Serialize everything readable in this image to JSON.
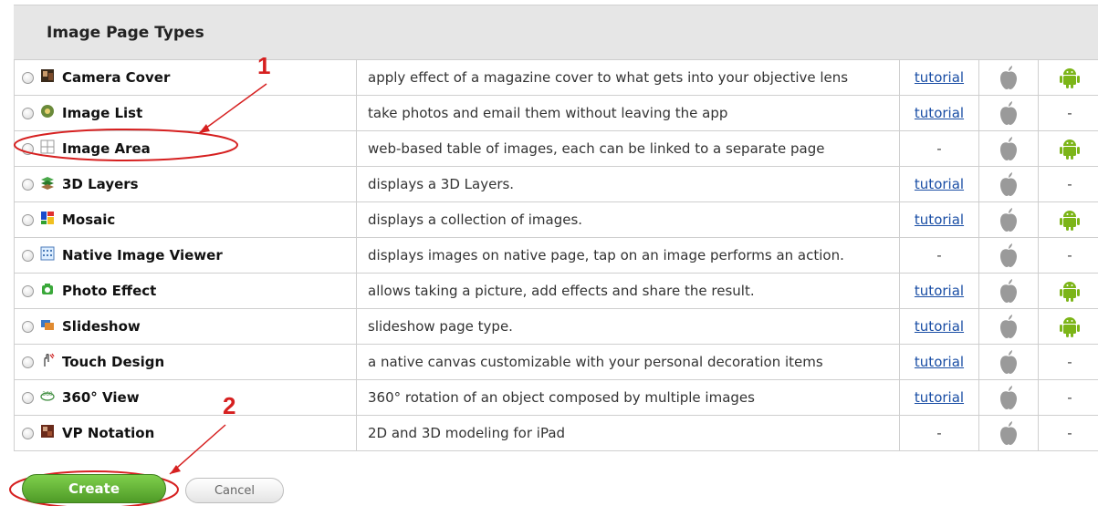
{
  "section": {
    "title": "Image Page Types"
  },
  "tutorial_link_label": "tutorial",
  "dash": "-",
  "rows": [
    {
      "name": "Camera Cover",
      "icon": "camera-cover-icon",
      "description": "apply effect of a magazine cover to what gets into your objective lens",
      "tutorial": true,
      "ios": true,
      "android": true
    },
    {
      "name": "Image List",
      "icon": "image-list-icon",
      "description": "take photos and email them without leaving the app",
      "tutorial": true,
      "ios": true,
      "android": false
    },
    {
      "name": "Image Area",
      "icon": "image-area-grid-icon",
      "description": "web-based table of images, each can be linked to a separate page",
      "tutorial": false,
      "ios": true,
      "android": true
    },
    {
      "name": "3D Layers",
      "icon": "3d-layers-icon",
      "description": "displays a 3D Layers.",
      "tutorial": true,
      "ios": true,
      "android": false
    },
    {
      "name": "Mosaic",
      "icon": "mosaic-icon",
      "description": "displays a collection of images.",
      "tutorial": true,
      "ios": true,
      "android": true
    },
    {
      "name": "Native Image Viewer",
      "icon": "native-image-viewer-icon",
      "description": "displays images on native page, tap on an image performs an action.",
      "tutorial": false,
      "ios": true,
      "android": false
    },
    {
      "name": "Photo Effect",
      "icon": "photo-effect-icon",
      "description": "allows taking a picture, add effects and share the result.",
      "tutorial": true,
      "ios": true,
      "android": true
    },
    {
      "name": "Slideshow",
      "icon": "slideshow-icon",
      "description": "slideshow page type.",
      "tutorial": true,
      "ios": true,
      "android": true
    },
    {
      "name": "Touch Design",
      "icon": "touch-design-icon",
      "description": "a native canvas customizable with your personal decoration items",
      "tutorial": true,
      "ios": true,
      "android": false
    },
    {
      "name": "360° View",
      "icon": "360-view-icon",
      "description": "360° rotation of an object composed by multiple images",
      "tutorial": true,
      "ios": true,
      "android": false
    },
    {
      "name": "VP Notation",
      "icon": "vp-notation-icon",
      "description": "2D and 3D modeling for iPad",
      "tutorial": false,
      "ios": true,
      "android": false
    }
  ],
  "buttons": {
    "create": "Create",
    "cancel": "Cancel"
  },
  "annotations": {
    "step1": "1",
    "step2": "2"
  },
  "colors": {
    "annotation": "#d62020",
    "create_green": "#5aa832",
    "link_blue": "#1a4ea5"
  }
}
